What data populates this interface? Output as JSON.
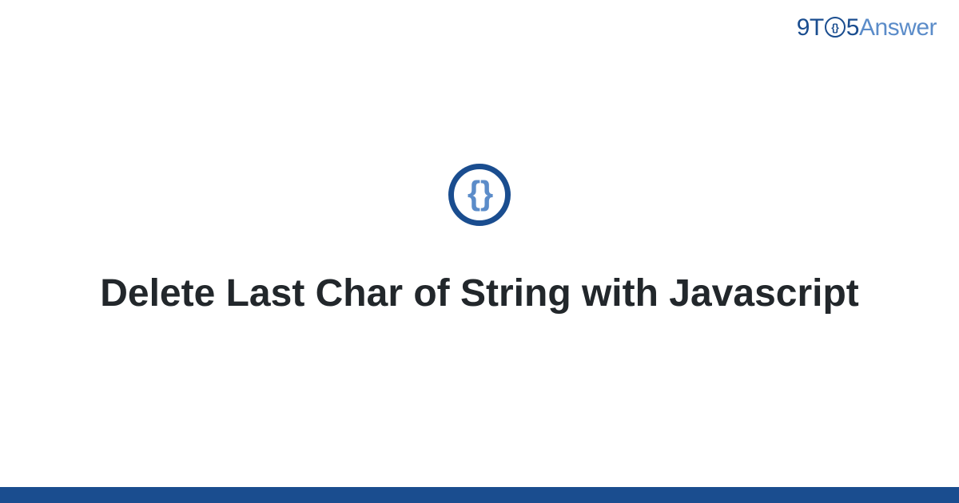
{
  "logo": {
    "part_9t": "9T",
    "part_o_inner": "{}",
    "part_5": "5",
    "part_answer": "Answer"
  },
  "badge": {
    "symbol": "{ }"
  },
  "title": "Delete Last Char of String with Javascript",
  "colors": {
    "brand_dark": "#1a4d8f",
    "brand_light": "#5b8cc9"
  }
}
